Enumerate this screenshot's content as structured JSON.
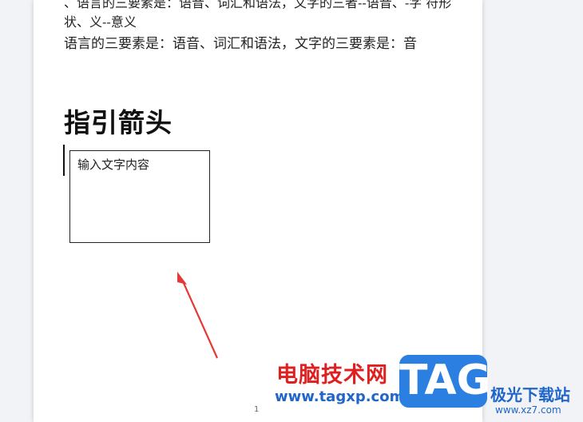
{
  "document": {
    "line1": "、语言的三要素是：语音、词汇和语法，文字的三者--语音、-字  符形状、义--意义",
    "line2": "语言的三要素是：语音、词汇和语法，文字的三要素是：音",
    "heading": "指引箭头",
    "textbox_text": "输入文字内容",
    "page_number": "1"
  },
  "watermark": {
    "title": "电脑技术网",
    "url": "www.tagxp.com",
    "tag": "TAG",
    "brand": "极光下载站",
    "brand_url": "www.xz7.com"
  },
  "colors": {
    "arrow": "#e53935",
    "accent": "#2a7fe0",
    "watermark_red": "#e02020"
  }
}
